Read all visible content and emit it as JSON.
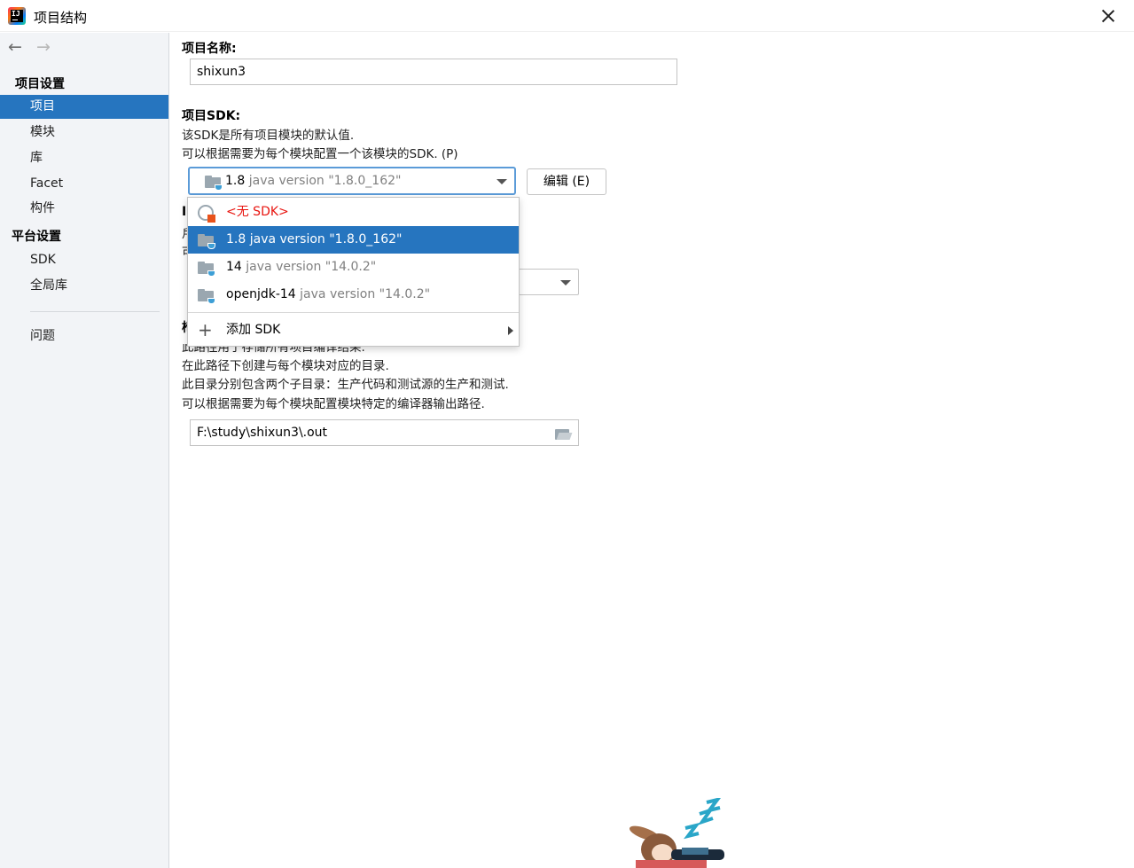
{
  "window": {
    "title": "项目结构"
  },
  "nav": {
    "back_icon": "arrow-left-icon",
    "forward_icon": "arrow-right-icon"
  },
  "sidebar": {
    "project_settings_header": "项目设置",
    "platform_settings_header": "平台设置",
    "items": [
      {
        "label": "项目",
        "selected": true
      },
      {
        "label": "模块",
        "selected": false
      },
      {
        "label": "库",
        "selected": false
      },
      {
        "label": "Facet",
        "selected": false
      },
      {
        "label": "构件",
        "selected": false
      }
    ],
    "platform_items": [
      {
        "label": "SDK"
      },
      {
        "label": "全局库"
      }
    ],
    "problems": "问题"
  },
  "main": {
    "project_name_label": "项目名称:",
    "project_name_value": "shixun3",
    "project_sdk_label": "项目SDK:",
    "sdk_desc_1": "该SDK是所有项目模块的默认值.",
    "sdk_desc_2": "可以根据需要为每个模块配置一个该模块的SDK. (P)",
    "sdk_combo": {
      "version": "1.8",
      "detail": "java version \"1.8.0_162\""
    },
    "edit_button": "编辑 (E)",
    "obscured_char_1": "I",
    "obscured_char_2": "戶",
    "obscured_char_3": "可",
    "obscured_char_4": "椅",
    "compiler_desc_0": "此路径用于存储所有项目编译结果.",
    "compiler_desc_1": "在此路径下创建与每个模块对应的目录.",
    "compiler_desc_2": "此目录分别包含两个子目录：生产代码和测试源的生产和测试.",
    "compiler_desc_3": "可以根据需要为每个模块配置模块特定的编译器输出路径.",
    "output_path": "F:\\study\\shixun3\\.out"
  },
  "dropdown": {
    "no_sdk": "<无 SDK>",
    "options": [
      {
        "name": "1.8",
        "detail": "java version \"1.8.0_162\"",
        "highlighted": true
      },
      {
        "name": "14",
        "detail": "java version \"14.0.2\"",
        "highlighted": false
      },
      {
        "name": "openjdk-14",
        "detail": "java version \"14.0.2\"",
        "highlighted": false
      }
    ],
    "add_sdk": "添加 SDK"
  },
  "colors": {
    "accent": "#2675bf",
    "sidebar_bg": "#f2f4f7",
    "error_red": "#e8140f"
  }
}
